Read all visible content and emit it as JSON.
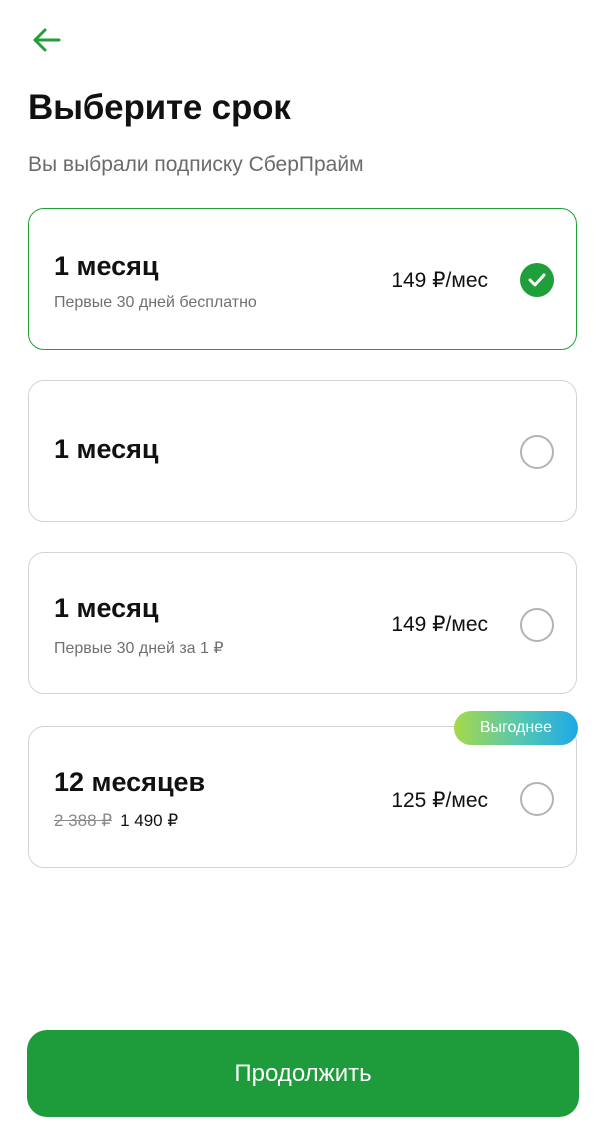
{
  "header": {
    "back_icon": "arrow-left-icon",
    "title": "Выберите срок",
    "subtitle": "Вы выбрали подписку СберПрайм"
  },
  "colors": {
    "accent": "#21a038",
    "button": "#1e9b3a",
    "radio_border": "#b3b3b3",
    "badge_gradient": [
      "#a8d84a",
      "#52c7b4",
      "#1fa8e8"
    ]
  },
  "plans": [
    {
      "title": "1 месяц",
      "subtitle": "Первые 30 дней бесплатно",
      "price": "149 ₽/мес",
      "selected": true
    },
    {
      "title": "1 месяц",
      "selected": false
    },
    {
      "title": "1 месяц",
      "subtitle": "Первые 30 дней за 1 ₽",
      "price": "149 ₽/мес",
      "selected": false
    },
    {
      "title": "12 месяцев",
      "old_price": "2 388 ₽",
      "new_price": "1 490 ₽",
      "price": "125 ₽/мес",
      "badge": "Выгоднее",
      "selected": false
    }
  ],
  "continue_button": {
    "label": "Продолжить"
  }
}
